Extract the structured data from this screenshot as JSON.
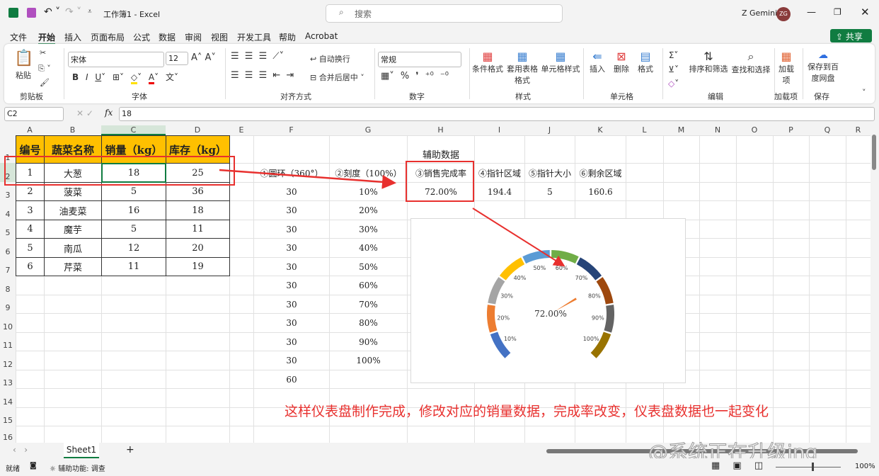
{
  "titlebar": {
    "title": "工作簿1 - Excel",
    "search_placeholder": "搜索",
    "user": "Z Gemini",
    "initials": "ZG"
  },
  "menu": [
    "文件",
    "开始",
    "插入",
    "页面布局",
    "公式",
    "数据",
    "审阅",
    "视图",
    "开发工具",
    "帮助",
    "Acrobat"
  ],
  "share": "共享",
  "ribbon": {
    "paste": "粘贴",
    "clipboard": "剪贴板",
    "font_name": "宋体",
    "font_size": "12",
    "font": "字体",
    "wrap": "自动换行",
    "merge": "合并后居中",
    "align": "对齐方式",
    "number_format": "常规",
    "number": "数字",
    "cond_format": "条件格式",
    "table_format": "套用表格格式",
    "cell_style": "单元格样式",
    "styles": "样式",
    "insert": "插入",
    "delete": "删除",
    "format": "格式",
    "cells": "单元格",
    "sort": "排序和筛选",
    "find": "查找和选择",
    "edit": "编辑",
    "addins": "加载项",
    "addins_group": "加载项",
    "save_baidu": "保存到百度网盘",
    "save": "保存"
  },
  "formula": {
    "namebox": "C2",
    "value": "18",
    "fx": "fx"
  },
  "columns": [
    "A",
    "B",
    "C",
    "D",
    "E",
    "F",
    "G",
    "H",
    "I",
    "J",
    "K",
    "L",
    "M",
    "N",
    "O",
    "P",
    "Q",
    "R"
  ],
  "rows": [
    "1",
    "2",
    "3",
    "4",
    "5",
    "6",
    "7",
    "8",
    "9",
    "10",
    "11",
    "12",
    "13",
    "14",
    "15",
    "16"
  ],
  "table": {
    "headers": [
      "编号",
      "蔬菜名称",
      "销量（kg）",
      "库存（kg）"
    ],
    "rows": [
      [
        "1",
        "大葱",
        "18",
        "25"
      ],
      [
        "2",
        "菠菜",
        "5",
        "36"
      ],
      [
        "3",
        "油麦菜",
        "16",
        "18"
      ],
      [
        "4",
        "魔芋",
        "5",
        "11"
      ],
      [
        "5",
        "南瓜",
        "12",
        "20"
      ],
      [
        "6",
        "芹菜",
        "11",
        "19"
      ]
    ]
  },
  "aux": {
    "title": "辅助数据",
    "headers": [
      "①圆环（360°）",
      "②刻度（100%）",
      "③销售完成率",
      "④指针区域",
      "⑤指针大小",
      "⑥剩余区域"
    ],
    "values": [
      "72.00%",
      "194.4",
      "5",
      "160.6"
    ],
    "ring": [
      "30",
      "30",
      "30",
      "30",
      "30",
      "30",
      "30",
      "30",
      "30",
      "30",
      "60"
    ],
    "scale": [
      "10%",
      "20%",
      "30%",
      "40%",
      "50%",
      "60%",
      "70%",
      "80%",
      "90%",
      "100%"
    ]
  },
  "gauge": {
    "value": 72.0,
    "center_label": "72.00%",
    "labels": [
      "10%",
      "20%",
      "30%",
      "40%",
      "50%",
      "60%",
      "70%",
      "80%",
      "90%",
      "100%"
    ],
    "colors": [
      "#4472c4",
      "#ed7d31",
      "#a5a5a5",
      "#ffc000",
      "#5b9bd5",
      "#70ad47",
      "#264478",
      "#9e480e",
      "#636363",
      "#997300"
    ],
    "needle_color": "#ed7d31"
  },
  "annotation": "这样仪表盘制作完成，修改对应的销量数据，完成率改变，仪表盘数据也一起变化",
  "watermark": "@系统正在升级ing",
  "sheet_tab": "Sheet1",
  "add_sheet": "+",
  "status": {
    "ready": "就绪",
    "accessibility": "辅助功能: 调查",
    "zoom": "100%"
  }
}
